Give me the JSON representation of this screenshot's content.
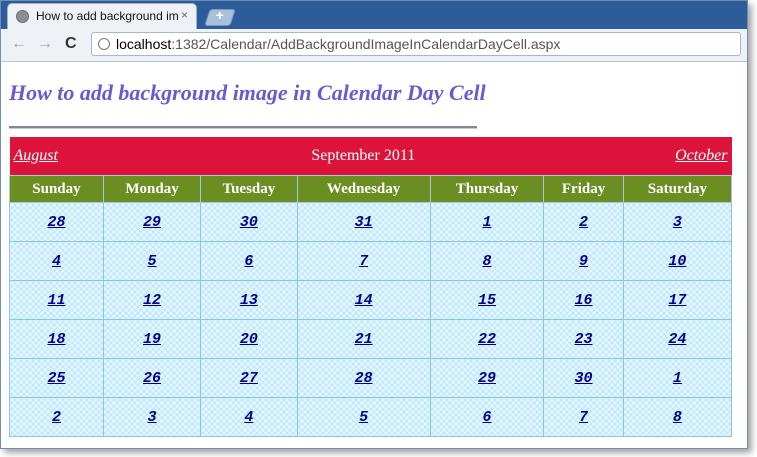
{
  "browser": {
    "tab_title": "How to add background im",
    "tab_close": "×",
    "new_tab": "+",
    "back_glyph": "←",
    "forward_glyph": "→",
    "reload_glyph": "C",
    "url_host": "localhost",
    "url_rest": ":1382/Calendar/AddBackgroundImageInCalendarDayCell.aspx"
  },
  "page": {
    "heading": "How to add background image in Calendar Day Cell"
  },
  "calendar": {
    "prev_month": "August",
    "current_month": "September 2011",
    "next_month": "October",
    "day_names": [
      "Sunday",
      "Monday",
      "Tuesday",
      "Wednesday",
      "Thursday",
      "Friday",
      "Saturday"
    ],
    "weeks": [
      [
        "28",
        "29",
        "30",
        "31",
        "1",
        "2",
        "3"
      ],
      [
        "4",
        "5",
        "6",
        "7",
        "8",
        "9",
        "10"
      ],
      [
        "11",
        "12",
        "13",
        "14",
        "15",
        "16",
        "17"
      ],
      [
        "18",
        "19",
        "20",
        "21",
        "22",
        "23",
        "24"
      ],
      [
        "25",
        "26",
        "27",
        "28",
        "29",
        "30",
        "1"
      ],
      [
        "2",
        "3",
        "4",
        "5",
        "6",
        "7",
        "8"
      ]
    ]
  },
  "colors": {
    "title_bar": "#dc143c",
    "day_header": "#6b8e23",
    "heading": "#6a5acd",
    "day_link": "#00008b"
  }
}
